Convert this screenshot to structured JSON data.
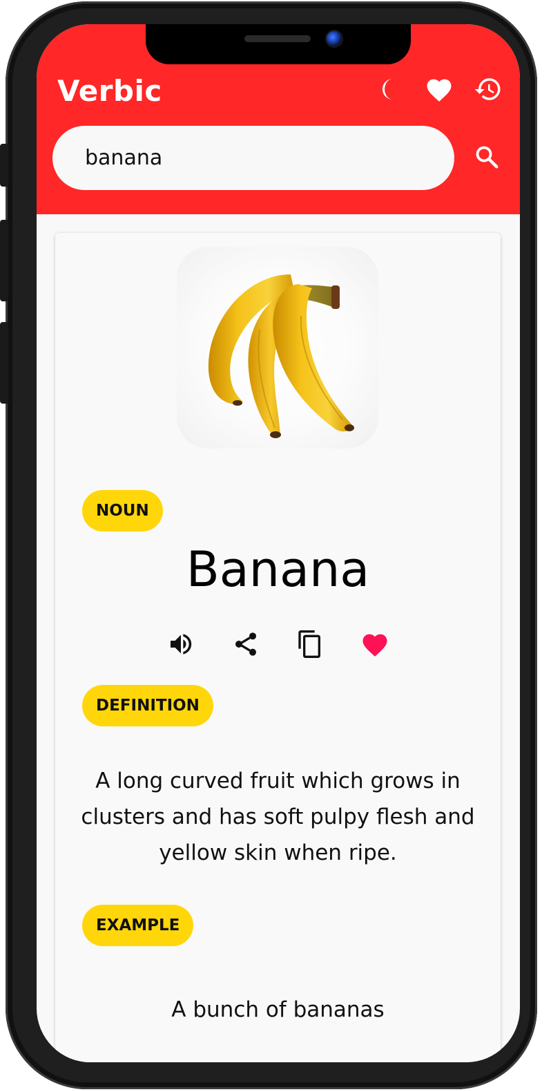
{
  "app": {
    "title": "Verbic",
    "accent_color": "#ff2727",
    "tag_color": "#ffd60a"
  },
  "header": {
    "icons": [
      "moon-icon",
      "heart-icon",
      "history-icon"
    ]
  },
  "search": {
    "value": "banana",
    "icon": "search-icon"
  },
  "entry": {
    "image_subject": "bunch of bananas",
    "part_of_speech": "NOUN",
    "word": "Banana",
    "actions": [
      "speaker-icon",
      "share-icon",
      "copy-icon",
      "heart-icon"
    ],
    "favorite_color": "#ff1155",
    "definition_label": "DEFINITION",
    "definition": "A long curved fruit which grows in clusters and has soft pulpy flesh and yellow skin when ripe.",
    "example_label": "EXAMPLE",
    "example": "A bunch of bananas"
  }
}
